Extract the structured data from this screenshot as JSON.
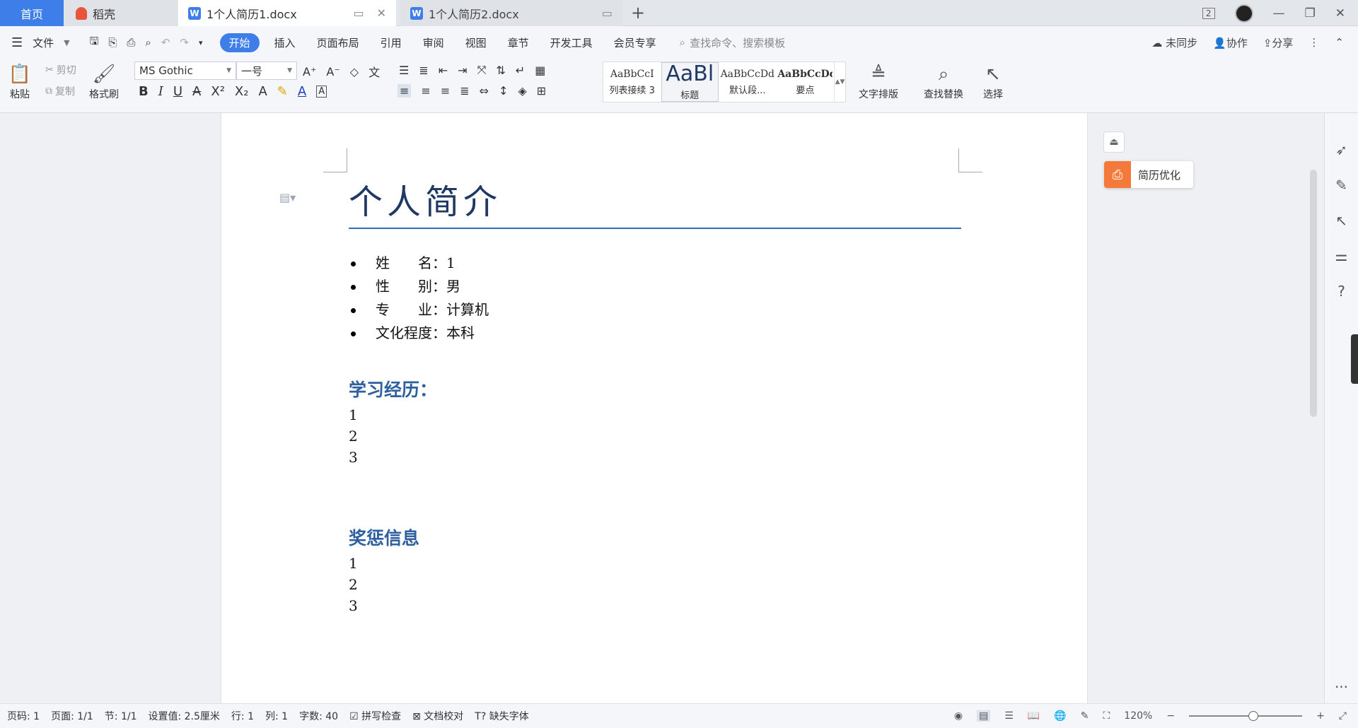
{
  "tabs": {
    "home": "首页",
    "daoke": "稻壳",
    "doc1": "1个人简历1.docx",
    "doc2": "1个人简历2.docx"
  },
  "window": {
    "badge": "2"
  },
  "menu": {
    "file": "文件",
    "items": [
      "开始",
      "插入",
      "页面布局",
      "引用",
      "审阅",
      "视图",
      "章节",
      "开发工具",
      "会员专享"
    ],
    "search_placeholder": "查找命令、搜索模板",
    "sync": "未同步",
    "collab": "协作",
    "share": "分享"
  },
  "toolbar": {
    "paste": "粘贴",
    "cut": "剪切",
    "copy": "复制",
    "format_painter": "格式刷",
    "font_name": "MS Gothic",
    "font_size": "一号",
    "styles": [
      {
        "preview": "AaBbCcI",
        "label": "列表接续 3"
      },
      {
        "preview": "AaBl",
        "label": "标题"
      },
      {
        "preview": "AaBbCcDd",
        "label": "默认段..."
      },
      {
        "preview": "AaBbCcDd",
        "label": "要点"
      }
    ],
    "text_layout": "文字排版",
    "find_replace": "查找替换",
    "select": "选择"
  },
  "document": {
    "title": "个人简介",
    "info": [
      "姓　　名：1",
      "性　　别：男",
      "专　　业：计算机",
      "文化程度：本科"
    ],
    "section1": {
      "heading": "学习经历：",
      "items": [
        "1",
        "2",
        "3"
      ]
    },
    "section2": {
      "heading": "奖惩信息",
      "items": [
        "1",
        "2",
        "3"
      ]
    }
  },
  "panel": {
    "resume_optimize": "简历优化"
  },
  "status": {
    "page_num": "页码: 1",
    "pages": "页面: 1/1",
    "section": "节: 1/1",
    "setting": "设置值: 2.5厘米",
    "row": "行: 1",
    "col": "列: 1",
    "word_count": "字数: 40",
    "spell_check": "拼写检查",
    "doc_proof": "文档校对",
    "missing_font": "缺失字体",
    "zoom": "120%"
  },
  "colors": {
    "accent": "#3e7ee8",
    "heading": "#1f3864",
    "section": "#2e5f9e",
    "resume_btn": "#f47a3c"
  }
}
